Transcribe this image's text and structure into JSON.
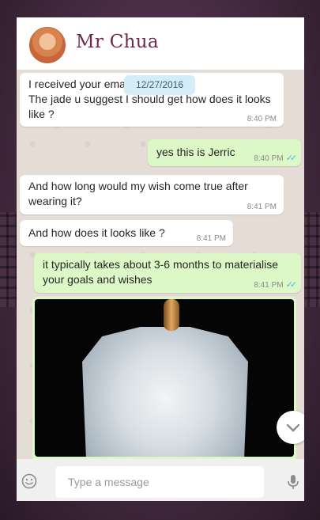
{
  "header": {
    "contact_name": "Mr Chua"
  },
  "date_pill": "12/27/2016",
  "messages": [
    {
      "dir": "in",
      "text": "I received your ema\nThe jade u suggest I should get how does it looks like ?",
      "time": "8:40 PM"
    },
    {
      "dir": "out",
      "text": "yes this is Jerric",
      "time": "8:40 PM",
      "ticks": "✓✓"
    },
    {
      "dir": "in",
      "text": "And how long would my wish come true after wearing it?",
      "time": "8:41 PM"
    },
    {
      "dir": "in",
      "text": "And how does it looks like ?",
      "time": "8:41 PM"
    },
    {
      "dir": "out",
      "text": "it typically takes about 3-6 months to materialise your goals and wishes",
      "time": "8:41 PM",
      "ticks": "✓✓"
    }
  ],
  "image": {
    "alt": "jade pendant"
  },
  "composer": {
    "placeholder": "Type a message"
  },
  "icons": {
    "scroll_down": "chevron-down-icon",
    "emoji": "emoji-icon",
    "mic": "microphone-icon",
    "side_arrow": "arrow-right-icon"
  },
  "colors": {
    "incoming_bubble": "#ffffff",
    "outgoing_bubble": "#dcf8c6",
    "title": "#6b2a4d",
    "read_ticks": "#4fb6ec",
    "chat_bg": "#e5ddd5"
  }
}
